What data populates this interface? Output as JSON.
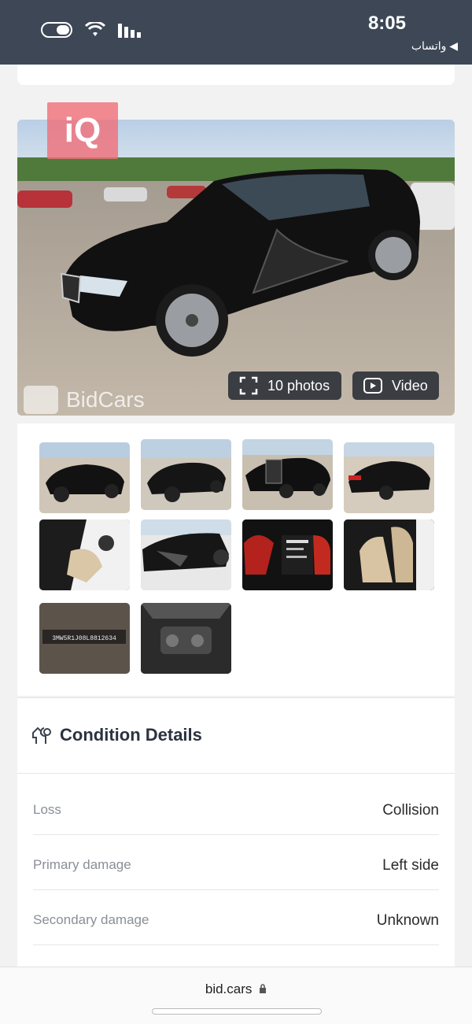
{
  "status_bar": {
    "time": "8:05",
    "back_app": "◀ واتساب"
  },
  "gallery": {
    "logo_text": "iQ",
    "watermark": "BidCars",
    "photos_button": "10 photos",
    "video_button": "Video",
    "thumbnails": [
      {
        "caption": "front-left-exterior"
      },
      {
        "caption": "front-left-exterior-2"
      },
      {
        "caption": "left-side-doors-open"
      },
      {
        "caption": "rear-right-exterior"
      },
      {
        "caption": "front-interior"
      },
      {
        "caption": "left-side-damage"
      },
      {
        "caption": "dashboard-cluster"
      },
      {
        "caption": "rear-interior"
      },
      {
        "caption": "vin-plate"
      },
      {
        "caption": "engine-bay"
      }
    ],
    "vin_text": "3MW5R1J08L8812634"
  },
  "condition": {
    "title": "Condition Details",
    "rows": [
      {
        "label": "Loss",
        "value": "Collision"
      },
      {
        "label": "Primary damage",
        "value": "Left side"
      },
      {
        "label": "Secondary damage",
        "value": "Unknown"
      }
    ]
  },
  "browser": {
    "url": "bid.cars"
  }
}
